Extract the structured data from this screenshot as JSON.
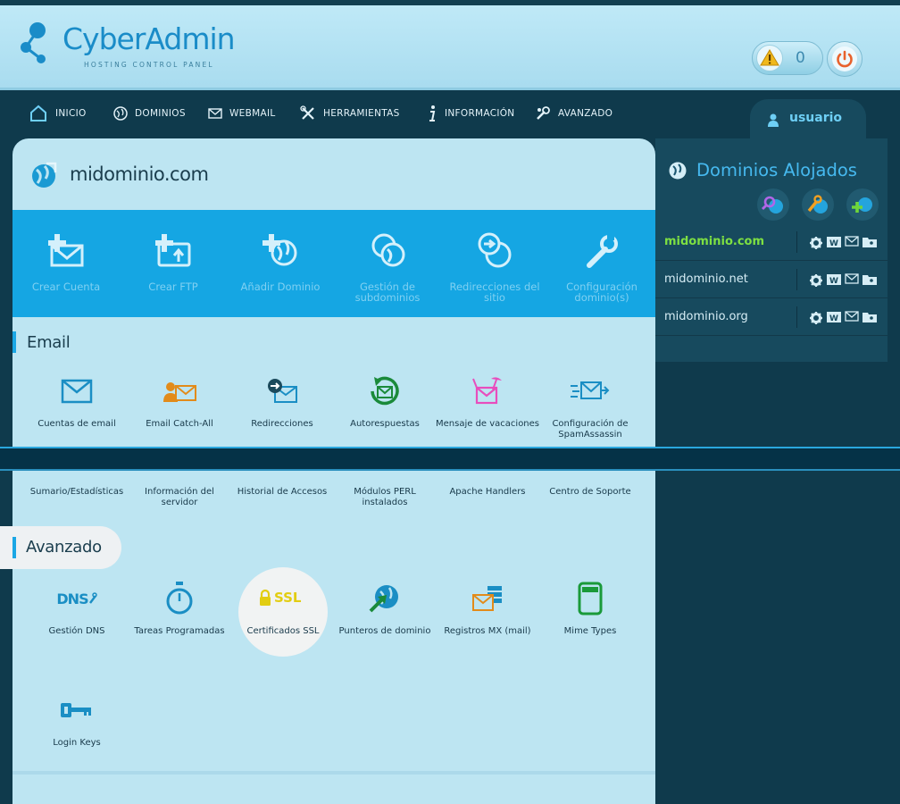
{
  "header": {
    "logo_text": "CyberAdmin",
    "logo_sub": "HOSTING CONTROL PANEL",
    "alert_count": "0"
  },
  "nav": {
    "items": [
      {
        "label": "INICIO",
        "icon": "home-icon"
      },
      {
        "label": "DOMINIOS",
        "icon": "globe-icon"
      },
      {
        "label": "WEBMAIL",
        "icon": "envelope-icon"
      },
      {
        "label": "HERRAMIENTAS",
        "icon": "tools-icon"
      },
      {
        "label": "INFORMACIÓN",
        "icon": "info-icon"
      },
      {
        "label": "AVANZADO",
        "icon": "wrench-gear-icon"
      }
    ],
    "user": "usuario"
  },
  "main": {
    "domain_title": "midominio.com",
    "quick_actions": [
      {
        "label": "Crear Cuenta",
        "icon": "add-mail-icon"
      },
      {
        "label": "Crear FTP",
        "icon": "add-ftp-icon"
      },
      {
        "label": "Añadir Dominio",
        "icon": "add-domain-icon"
      },
      {
        "label": "Gestión de subdominios",
        "icon": "globe-group-icon"
      },
      {
        "label": "Redirecciones del sitio",
        "icon": "globe-redirect-icon"
      },
      {
        "label": "Configuración dominio(s)",
        "icon": "wrench-icon"
      }
    ],
    "email_section": {
      "title": "Email",
      "items": [
        {
          "label": "Cuentas de email",
          "icon": "envelope-icon"
        },
        {
          "label": "Email Catch-All",
          "icon": "catch-all-icon"
        },
        {
          "label": "Redirecciones",
          "icon": "mail-redirect-icon"
        },
        {
          "label": "Autorespuestas",
          "icon": "autoresponder-icon"
        },
        {
          "label": "Mensaje de vacaciones",
          "icon": "vacation-icon"
        },
        {
          "label": "Configuración de SpamAssassin",
          "icon": "spam-icon"
        }
      ]
    },
    "info_items": [
      {
        "label": "Sumario/Estadísticas"
      },
      {
        "label": "Información del servidor"
      },
      {
        "label": "Historial de Accesos"
      },
      {
        "label": "Módulos PERL instalados"
      },
      {
        "label": "Apache Handlers"
      },
      {
        "label": "Centro de Soporte"
      }
    ],
    "advanced_section": {
      "title": "Avanzado",
      "items": [
        {
          "label": "Gestión DNS",
          "icon": "dns-icon"
        },
        {
          "label": "Tareas Programadas",
          "icon": "stopwatch-icon"
        },
        {
          "label": "Certificados SSL",
          "icon": "ssl-lock-icon"
        },
        {
          "label": "Punteros de dominio",
          "icon": "domain-pointer-icon"
        },
        {
          "label": "Registros MX (mail)",
          "icon": "mx-records-icon"
        },
        {
          "label": "Mime Types",
          "icon": "mime-icon"
        },
        {
          "label": "Login Keys",
          "icon": "key-icon"
        }
      ],
      "dns_text": "DNS",
      "ssl_text": "SSL"
    }
  },
  "sidebar": {
    "title": "Dominios Alojados",
    "domains": [
      {
        "name": "midominio.com",
        "active": true
      },
      {
        "name": "midominio.net",
        "active": false
      },
      {
        "name": "midominio.org",
        "active": false
      }
    ]
  },
  "colors": {
    "accent": "#15a6e3",
    "active_domain": "#7ee042",
    "panel": "#bde5f2"
  }
}
